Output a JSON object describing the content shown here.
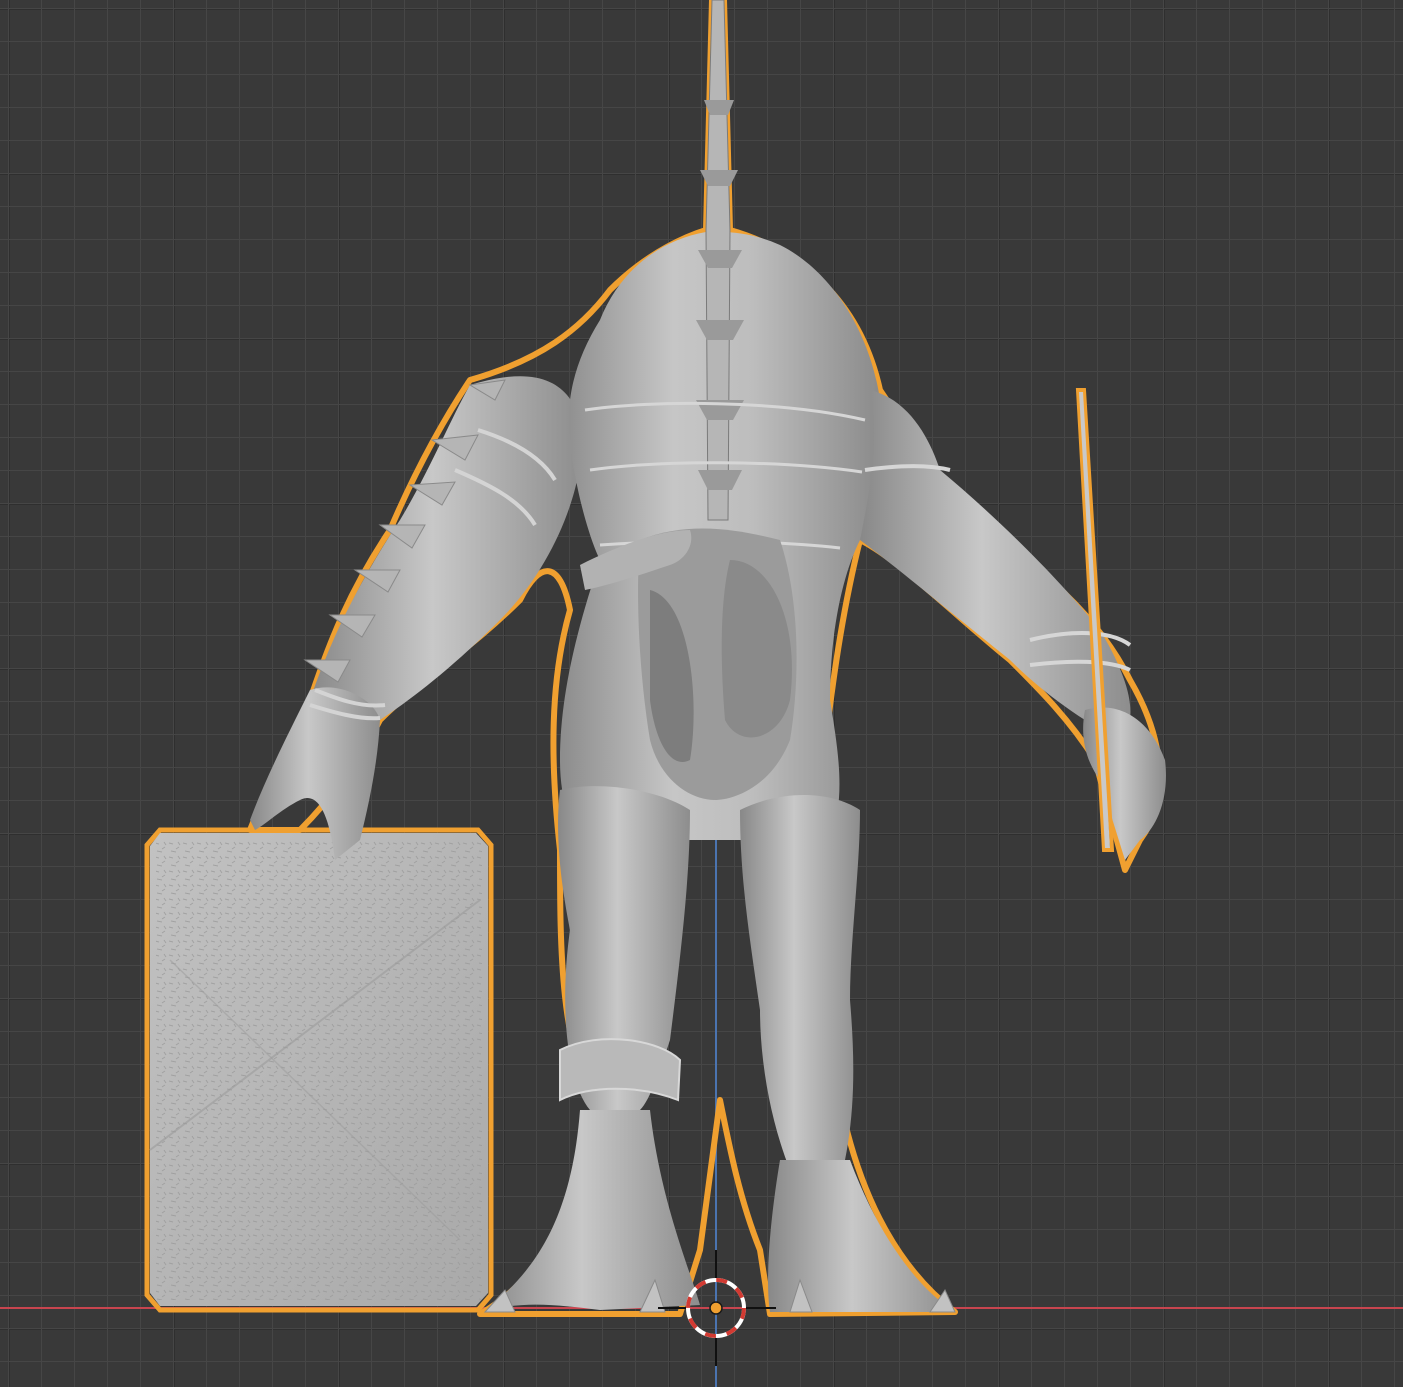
{
  "viewport": {
    "view": "back-orthographic",
    "background_color": "#393939",
    "grid_minor_color": "#464646",
    "grid_major_color": "#2f2f2f"
  },
  "axes": {
    "x_axis_color": "#c8454f",
    "z_axis_color": "#4b74b0"
  },
  "selection": {
    "outline_color": "#f0a030",
    "selected_objects": [
      "creature-sculpt",
      "tablet-slab"
    ]
  },
  "materials": {
    "clay_light": "#c4c4c4",
    "clay_mid": "#a8a8a8",
    "clay_dark": "#7e7e7e"
  },
  "cursor": {
    "ring_color_a": "#ffffff",
    "ring_color_b": "#d23a32",
    "origin_color": "#f0a030"
  }
}
